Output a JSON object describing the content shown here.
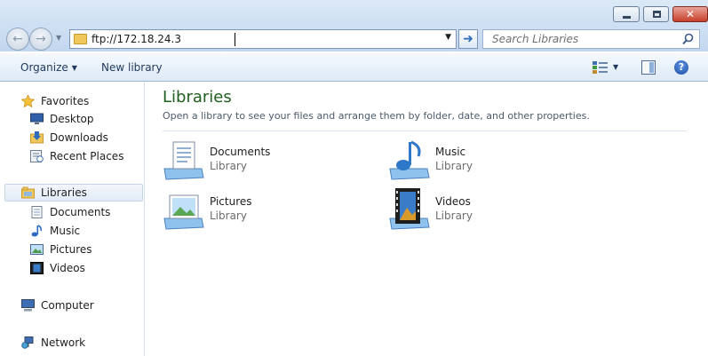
{
  "window": {
    "min_label": "",
    "max_label": "",
    "close_label": "✕"
  },
  "address": {
    "value": "ftp://172.18.24.3",
    "search_placeholder": "Search Libraries"
  },
  "toolbar": {
    "organize_label": "Organize",
    "newlib_label": "New library"
  },
  "sidebar": {
    "favorites": "Favorites",
    "fav_items": [
      "Desktop",
      "Downloads",
      "Recent Places"
    ],
    "libraries": "Libraries",
    "lib_items": [
      "Documents",
      "Music",
      "Pictures",
      "Videos"
    ],
    "computer": "Computer",
    "network": "Network"
  },
  "content": {
    "title": "Libraries",
    "description": "Open a library to see your files and arrange them by folder, date, and other properties.",
    "libraries": [
      {
        "name": "Documents",
        "type": "Library"
      },
      {
        "name": "Music",
        "type": "Library"
      },
      {
        "name": "Pictures",
        "type": "Library"
      },
      {
        "name": "Videos",
        "type": "Library"
      }
    ]
  }
}
